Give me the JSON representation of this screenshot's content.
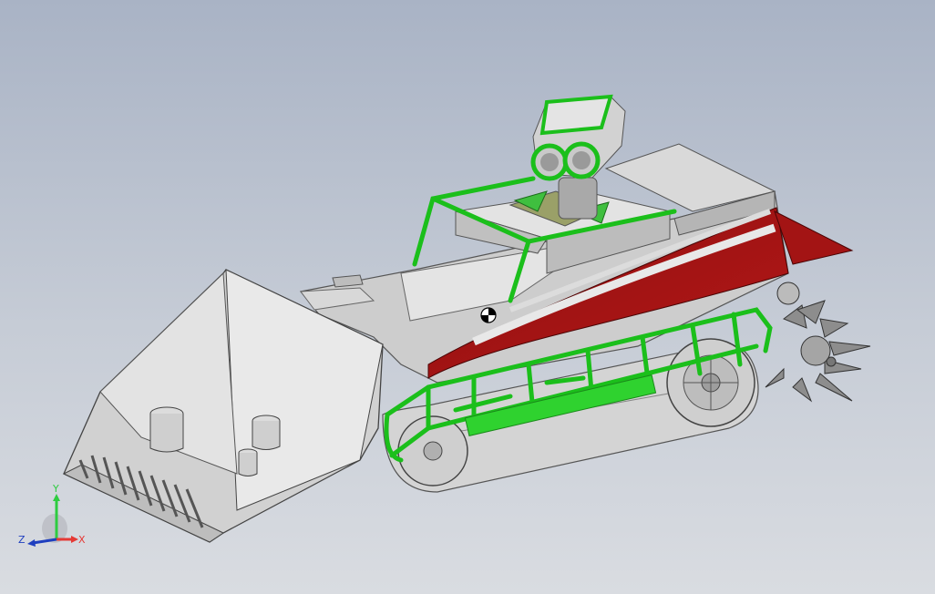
{
  "view": {
    "colors": {
      "body": "#c9c9c9",
      "body_dark": "#9a9a9a",
      "frame": "#1bbf1b",
      "accent_red": "#a31414",
      "bucket": "#cfcfcf"
    }
  },
  "triad": {
    "x_label": "X",
    "y_label": "Y",
    "z_label": "Z",
    "x_color": "#e53935",
    "y_color": "#2ecc40",
    "z_color": "#1f3fbf"
  }
}
